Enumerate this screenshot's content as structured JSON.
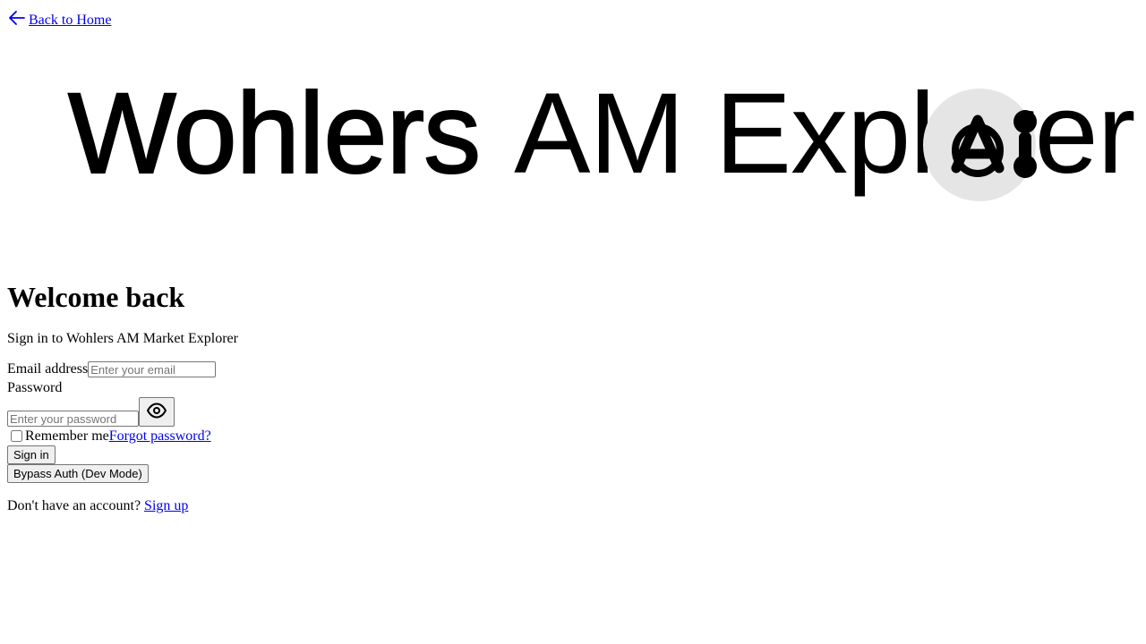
{
  "nav": {
    "back_label": "Back to Home",
    "back_icon": "arrow-left-icon"
  },
  "hero": {
    "brand": "Wohlers",
    "product": "AM Explorer",
    "logo_icon": "ai-logo-icon",
    "logo_bg": "#e5e5e5"
  },
  "login": {
    "title": "Welcome back",
    "subtitle": "Sign in to Wohlers AM Market Explorer",
    "email_label": "Email address",
    "email_placeholder": "Enter your email",
    "email_value": "",
    "password_label": "Password",
    "password_placeholder": "Enter your password",
    "password_value": "",
    "show_password_icon": "eye-icon",
    "remember_label": "Remember me",
    "remember_checked": false,
    "forgot_label": "Forgot password?",
    "signin_label": "Sign in",
    "bypass_label": "Bypass Auth (Dev Mode)",
    "signup_prompt": "Don't have an account?",
    "signup_label": "Sign up"
  },
  "colors": {
    "link": "#0000ee",
    "text": "#000000"
  }
}
